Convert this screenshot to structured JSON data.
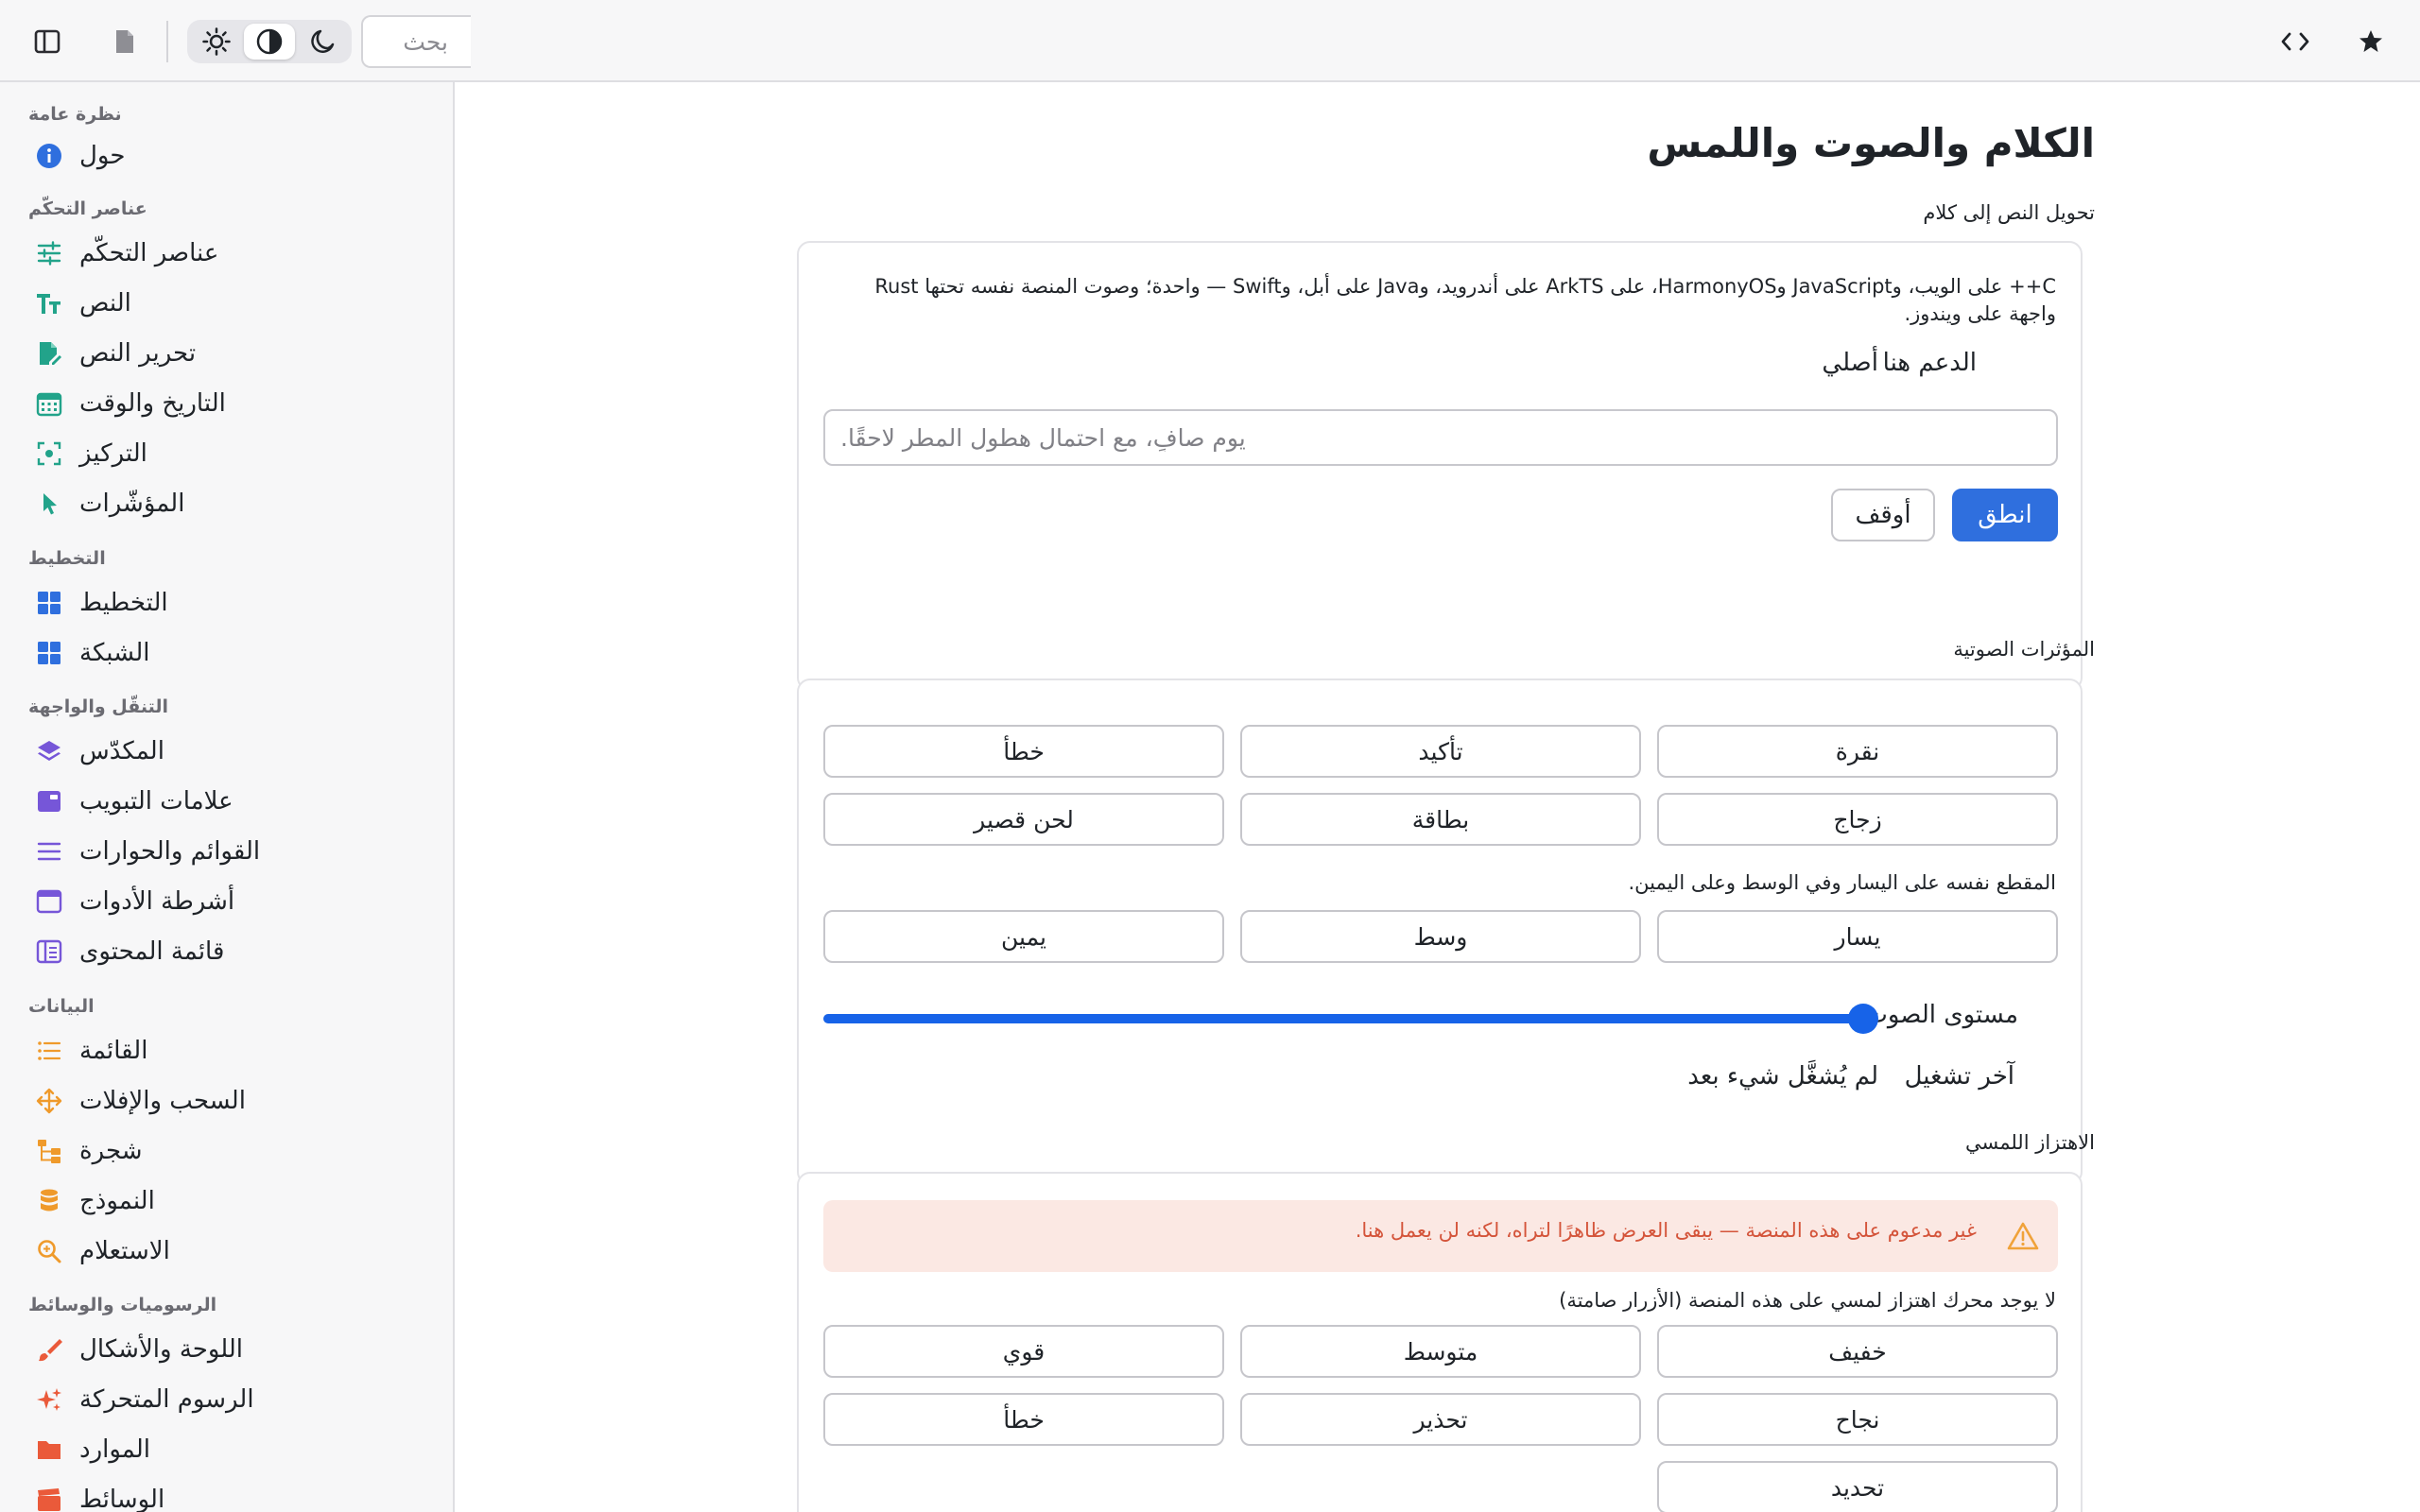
{
  "toolbar": {
    "search_placeholder": "بحث",
    "icons": [
      "sidebar-toggle-icon",
      "document-icon",
      "sun-icon",
      "contrast-icon",
      "moon-icon",
      "code-icon",
      "star-icon"
    ],
    "active_theme": "contrast"
  },
  "sidebar": {
    "sections": [
      {
        "title": "نظرة عامة",
        "items": [
          {
            "label": "حول",
            "icon": "info-icon",
            "color": "#2f6fde"
          }
        ]
      },
      {
        "title": "عناصر التحكّم",
        "items": [
          {
            "label": "عناصر التحكّم",
            "icon": "sliders-icon",
            "color": "#22a38a"
          },
          {
            "label": "النص",
            "icon": "text-icon",
            "color": "#22a38a"
          },
          {
            "label": "تحرير النص",
            "icon": "edit-document-icon",
            "color": "#22a38a"
          },
          {
            "label": "التاريخ والوقت",
            "icon": "calendar-icon",
            "color": "#22a38a"
          },
          {
            "label": "التركيز",
            "icon": "focus-icon",
            "color": "#22a38a"
          },
          {
            "label": "المؤشّرات",
            "icon": "pointer-icon",
            "color": "#22a38a"
          }
        ]
      },
      {
        "title": "التخطيط",
        "items": [
          {
            "label": "التخطيط",
            "icon": "layout-icon",
            "color": "#2f6fde"
          },
          {
            "label": "الشبكة",
            "icon": "grid-icon",
            "color": "#2f6fde"
          }
        ]
      },
      {
        "title": "التنقّل والواجهة",
        "items": [
          {
            "label": "المكدّس",
            "icon": "stack-icon",
            "color": "#7656d8"
          },
          {
            "label": "علامات التبويب",
            "icon": "tabs-icon",
            "color": "#7656d8"
          },
          {
            "label": "القوائم والحوارات",
            "icon": "menu-icon",
            "color": "#7656d8"
          },
          {
            "label": "أشرطة الأدوات",
            "icon": "toolbar-icon",
            "color": "#7656d8"
          },
          {
            "label": "قائمة المحتوى",
            "icon": "content-list-icon",
            "color": "#7656d8"
          }
        ]
      },
      {
        "title": "البيانات",
        "items": [
          {
            "label": "القائمة",
            "icon": "list-icon",
            "color": "#ef9a2b"
          },
          {
            "label": "السحب والإفلات",
            "icon": "move-icon",
            "color": "#ef9a2b"
          },
          {
            "label": "شجرة",
            "icon": "tree-icon",
            "color": "#ef9a2b"
          },
          {
            "label": "النموذج",
            "icon": "database-icon",
            "color": "#ef9a2b"
          },
          {
            "label": "الاستعلام",
            "icon": "search-zoom-icon",
            "color": "#ef9a2b"
          }
        ]
      },
      {
        "title": "الرسوميات والوسائط",
        "items": [
          {
            "label": "اللوحة والأشكال",
            "icon": "brush-icon",
            "color": "#ea5a3a"
          },
          {
            "label": "الرسوم المتحركة",
            "icon": "sparkle-icon",
            "color": "#ea5a3a"
          },
          {
            "label": "الموارد",
            "icon": "folder-icon",
            "color": "#ea5a3a"
          },
          {
            "label": "الوسائط",
            "icon": "clapper-icon",
            "color": "#ea5a3a"
          }
        ]
      }
    ]
  },
  "main": {
    "title": "الكلام والصوت واللمس",
    "tts": {
      "group_label": "تحويل النص إلى كلام",
      "description": "‏C++‏ على الويب، و‏JavaScript‏ و‏HarmonyOS‏، على ‏ArkTS‏ على أندرويد، و‏Java‏ على أبل، و‏Swift‏ — واحدة؛ وصوت المنصة نفسه تحتها ‏Rust‏ واجهة على ويندوز.",
      "support_label": "الدعم هنا",
      "support_value": "أصلي",
      "input_placeholder": "يوم صافٍ، مع احتمال هطول المطر لاحقًا.",
      "speak_label": "انطق",
      "stop_label": "أوقف"
    },
    "sfx": {
      "group_label": "المؤثرات الصوتية",
      "row1": [
        "نقرة",
        "تأكيد",
        "خطأ"
      ],
      "row2": [
        "زجاج",
        "بطاقة",
        "لحن قصير"
      ],
      "pan_note": "المقطع نفسه على اليسار وفي الوسط وعلى اليمين.",
      "pan_row": [
        "يسار",
        "وسط",
        "يمين"
      ],
      "volume_label": "مستوى الصوت",
      "volume_value": 1.0,
      "last_played_label": "آخر تشغيل",
      "last_played_value": "لم يُشغَّل شيء بعد"
    },
    "haptics": {
      "group_label": "الاهتزاز اللمسي",
      "warning": "غير مدعوم على هذه المنصة — يبقى العرض ظاهرًا لتراه، لكنه لن يعمل هنا.",
      "note": "لا يوجد محرك اهتزاز لمسي على هذه المنصة (الأزرار صامتة)",
      "row1": [
        "خفيف",
        "متوسط",
        "قوي"
      ],
      "row2": [
        "نجاح",
        "تحذير",
        "خطأ"
      ],
      "row3": [
        "تحديد"
      ]
    }
  }
}
